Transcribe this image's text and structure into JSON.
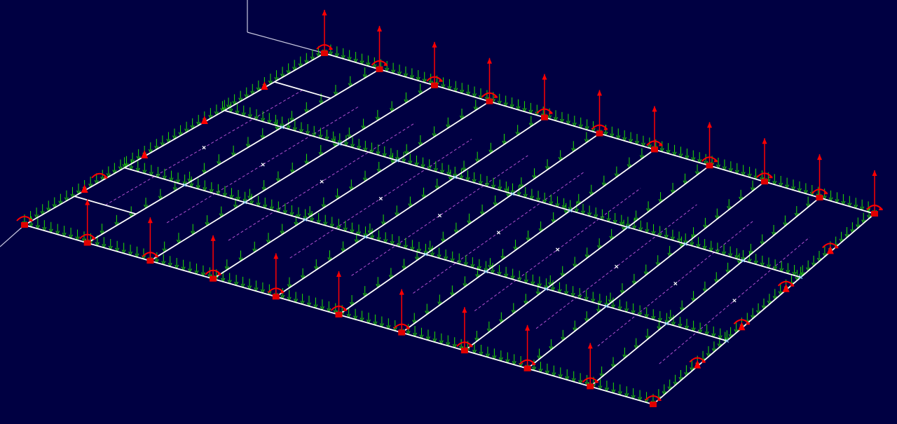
{
  "viewport": {
    "background": "#000042"
  },
  "colors": {
    "background": "#000042",
    "beam": "#ffffff",
    "axis": "#c8c8e0",
    "load_arrow": "#22e000",
    "reaction": "#ff0000",
    "node_marker": "#e00000",
    "mid_marker": "#ffffff",
    "connection_marker": "#8fd0ff",
    "secondary_line": "#b050d0"
  },
  "model": {
    "view": "isometric",
    "grid": {
      "bays_long_side": 10,
      "bays_short_side": 3,
      "internal_lines_short": 2
    },
    "load_symbol": "distributed-load-arrows",
    "support_symbol": "reaction-arrow-and-moment",
    "mid_point_symbol": "cross-marker",
    "icons": [
      "axis-line",
      "beam-line",
      "load-arrow-icon",
      "reaction-arrow-icon",
      "moment-arc-icon",
      "node-marker-icon",
      "cross-marker-icon"
    ]
  }
}
